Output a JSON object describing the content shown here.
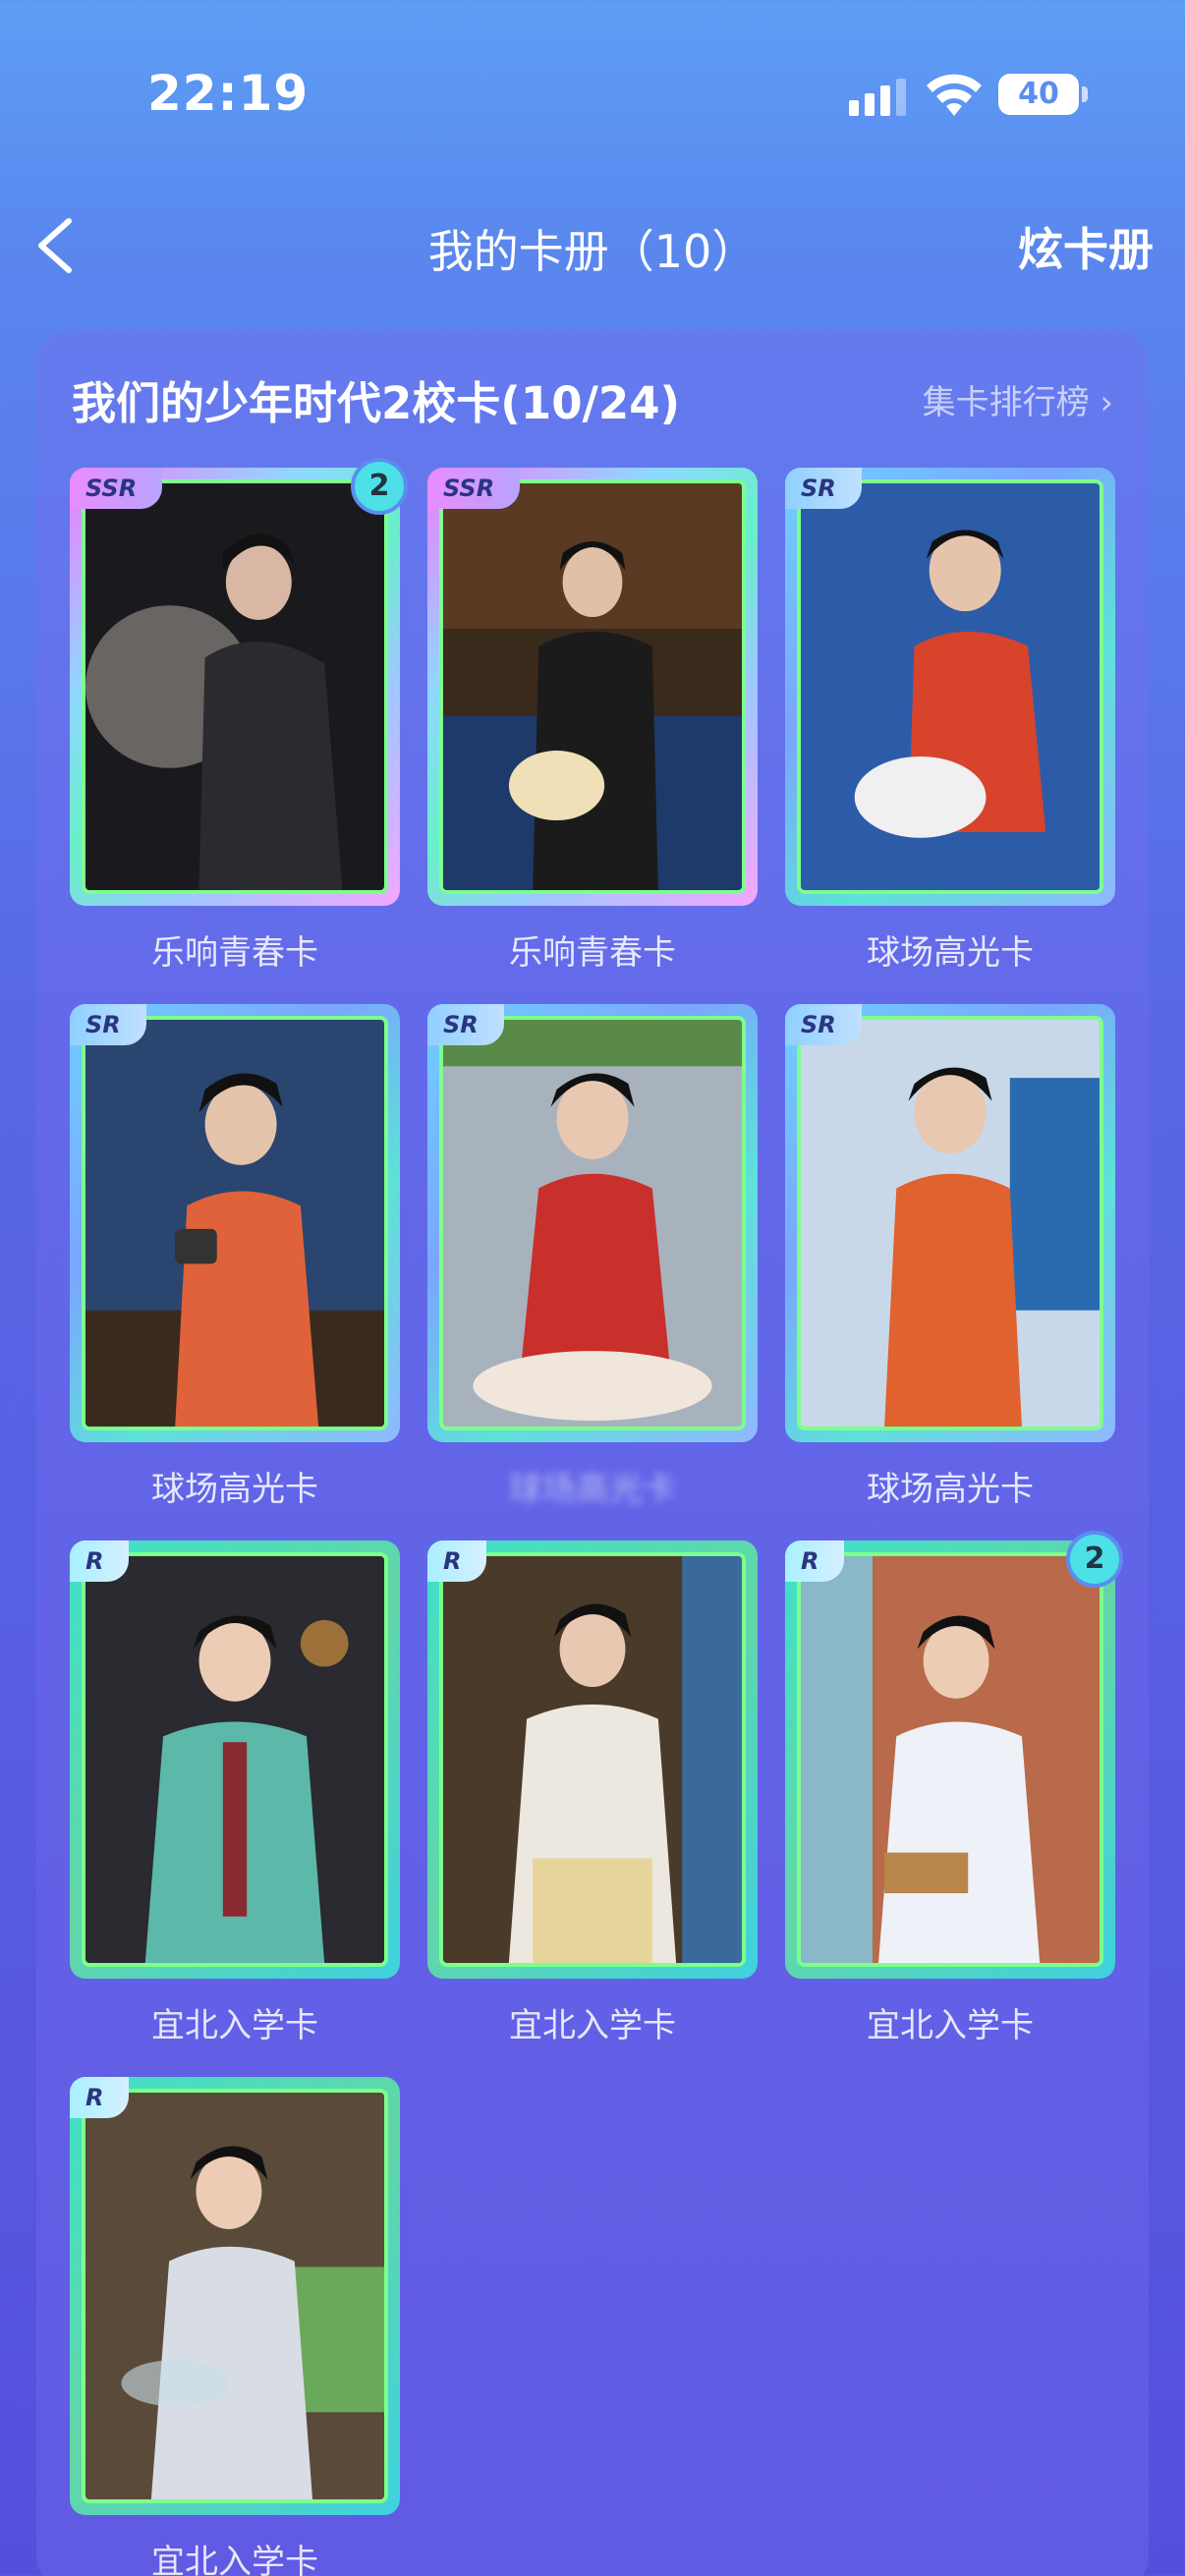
{
  "status": {
    "time": "22:19",
    "battery": "40"
  },
  "nav": {
    "title": "我的卡册（10）",
    "right_action": "炫卡册"
  },
  "album": {
    "title": "我们的少年时代2校卡(10/24)",
    "ranking_link": "集卡排行榜 ›",
    "cards": [
      {
        "rarity": "SSR",
        "name": "乐响青春卡",
        "count": "2"
      },
      {
        "rarity": "SSR",
        "name": "乐响青春卡",
        "count": ""
      },
      {
        "rarity": "SR",
        "name": "球场高光卡",
        "count": ""
      },
      {
        "rarity": "SR",
        "name": "球场高光卡",
        "count": ""
      },
      {
        "rarity": "SR",
        "name": "球场高光卡",
        "count": ""
      },
      {
        "rarity": "SR",
        "name": "球场高光卡",
        "count": ""
      },
      {
        "rarity": "R",
        "name": "宜北入学卡",
        "count": ""
      },
      {
        "rarity": "R",
        "name": "宜北入学卡",
        "count": ""
      },
      {
        "rarity": "R",
        "name": "宜北入学卡",
        "count": "2"
      },
      {
        "rarity": "R",
        "name": "宜北入学卡",
        "count": ""
      }
    ]
  },
  "colors": {
    "bg_top": "#5d9ef5",
    "bg_bottom": "#5550dc",
    "count_badge": "#4de0e6"
  }
}
